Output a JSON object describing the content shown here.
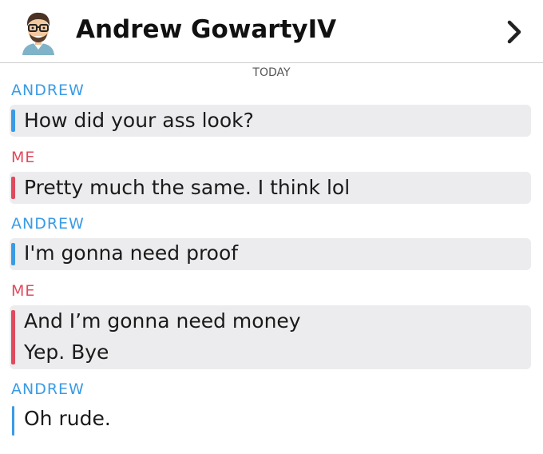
{
  "header": {
    "contact_name": "Andrew GowartyIV",
    "avatar_icon": "bitmoji-avatar-icon",
    "chevron_icon": "chevron-right-icon"
  },
  "date_divider": "TODAY",
  "colors": {
    "andrew": "#3a9be5",
    "me": "#e04a5e",
    "bubble_bg": "#ececee"
  },
  "messages": [
    {
      "sender": "ANDREW",
      "lines": [
        "How did your ass look?"
      ]
    },
    {
      "sender": "ME",
      "lines": [
        "Pretty much the same. I think lol"
      ]
    },
    {
      "sender": "ANDREW",
      "lines": [
        "I'm gonna need proof"
      ]
    },
    {
      "sender": "ME",
      "lines": [
        "And I’m gonna need money",
        "Yep. Bye"
      ]
    },
    {
      "sender": "ANDREW",
      "lines": [
        "Oh rude."
      ]
    }
  ]
}
